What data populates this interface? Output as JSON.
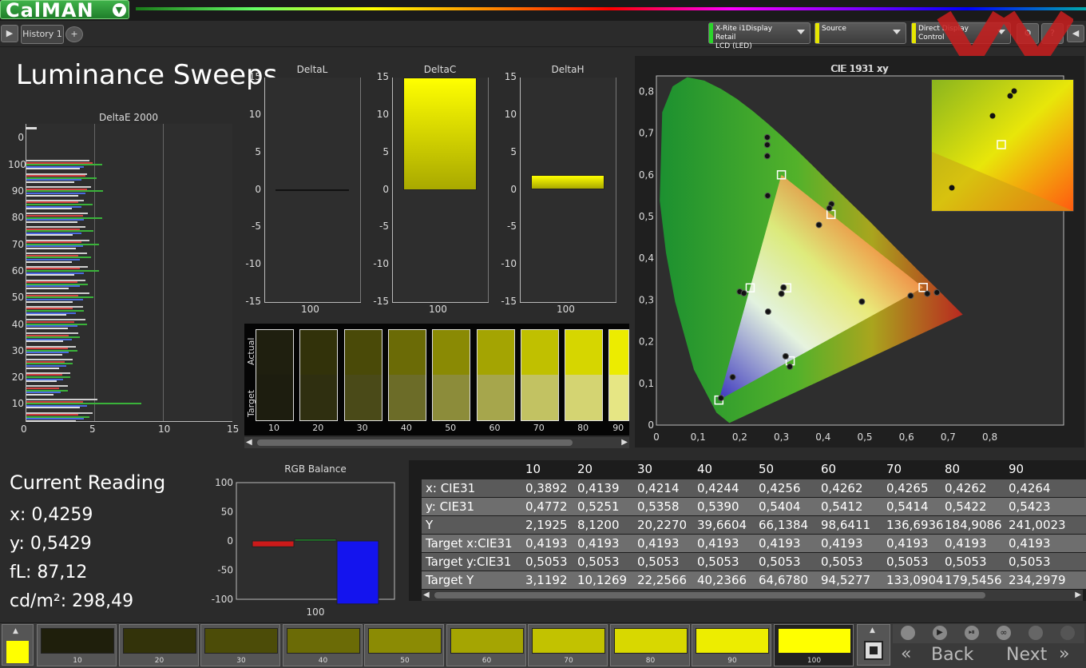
{
  "app": {
    "logo": "CalMAN",
    "history_tab": "History 1"
  },
  "toolbar": {
    "meter": {
      "line1": "X-Rite i1Display Retail",
      "line2": "LCD (LED)",
      "color": "#2bd42b"
    },
    "source": {
      "label": "Source",
      "color": "#e6e600"
    },
    "display": {
      "label": "Direct Display Control",
      "color": "#e6e600"
    }
  },
  "page_title": "Luminance Sweeps",
  "deltae": {
    "title": "DeltaE 2000",
    "xticks": [
      "0",
      "5",
      "10",
      "15"
    ],
    "yticks": [
      "0",
      "100",
      "90",
      "80",
      "70",
      "60",
      "50",
      "40",
      "30",
      "20",
      "10"
    ],
    "series_colors": [
      "#cfcfcf",
      "#d04040",
      "#3ab33a",
      "#4a6ae0",
      "#e0e0e0"
    ],
    "levels": [
      {
        "level": 100,
        "values": [
          4.6,
          4.8,
          5.5,
          4.2,
          3.9
        ]
      },
      {
        "level": 95,
        "values": [
          4.4,
          4.3,
          5.1,
          4.0,
          3.5
        ]
      },
      {
        "level": 90,
        "values": [
          4.7,
          4.4,
          5.6,
          4.3,
          3.8
        ]
      },
      {
        "level": 85,
        "values": [
          4.2,
          3.8,
          4.8,
          4.0,
          3.3
        ]
      },
      {
        "level": 80,
        "values": [
          4.5,
          4.1,
          5.5,
          4.2,
          3.7
        ]
      },
      {
        "level": 75,
        "values": [
          4.3,
          3.9,
          4.9,
          4.0,
          3.4
        ]
      },
      {
        "level": 70,
        "values": [
          4.6,
          4.0,
          5.3,
          4.1,
          3.6
        ]
      },
      {
        "level": 65,
        "values": [
          4.4,
          3.8,
          4.7,
          3.9,
          3.3
        ]
      },
      {
        "level": 60,
        "values": [
          4.5,
          3.9,
          5.3,
          4.2,
          3.5
        ]
      },
      {
        "level": 55,
        "values": [
          4.3,
          3.7,
          4.5,
          3.9,
          3.1
        ]
      },
      {
        "level": 50,
        "values": [
          4.6,
          3.8,
          4.9,
          4.1,
          3.4
        ]
      },
      {
        "level": 45,
        "values": [
          4.1,
          3.4,
          4.2,
          3.6,
          2.9
        ]
      },
      {
        "level": 40,
        "values": [
          4.3,
          3.5,
          4.4,
          3.7,
          3.0
        ]
      },
      {
        "level": 35,
        "values": [
          3.8,
          3.1,
          3.9,
          3.3,
          2.7
        ]
      },
      {
        "level": 30,
        "values": [
          3.6,
          3.0,
          3.7,
          3.1,
          2.6
        ]
      },
      {
        "level": 25,
        "values": [
          3.4,
          2.8,
          3.4,
          2.9,
          2.4
        ]
      },
      {
        "level": 20,
        "values": [
          3.2,
          2.6,
          3.2,
          2.7,
          2.2
        ]
      },
      {
        "level": 15,
        "values": [
          3.0,
          2.4,
          3.0,
          2.5,
          2.0
        ]
      },
      {
        "level": 10,
        "values": [
          5.2,
          4.1,
          8.4,
          4.4,
          3.9
        ]
      },
      {
        "level": 5,
        "values": [
          4.8,
          3.8,
          4.6,
          4.2,
          3.6
        ]
      }
    ],
    "zero_bar": 0.8
  },
  "small_charts": [
    {
      "title": "DeltaL",
      "xlabel": "100",
      "value": 0.0,
      "yticks": [
        "15",
        "10",
        "5",
        "0",
        "-5",
        "-10",
        "-15"
      ]
    },
    {
      "title": "DeltaC",
      "xlabel": "100",
      "value": 15.0,
      "yticks": [
        "15",
        "10",
        "5",
        "0",
        "-5",
        "-10",
        "-15"
      ]
    },
    {
      "title": "DeltaH",
      "xlabel": "100",
      "value": 2.0,
      "yticks": [
        "15",
        "10",
        "5",
        "0",
        "-5",
        "-10",
        "-15"
      ]
    }
  ],
  "swatches": {
    "actual_label": "Actual",
    "target_label": "Target",
    "items": [
      {
        "label": "10",
        "actual": "#1f1f0f",
        "target": "#1d1d0f"
      },
      {
        "label": "20",
        "actual": "#32320a",
        "target": "#2f2f10"
      },
      {
        "label": "30",
        "actual": "#4a4a08",
        "target": "#4a4a18"
      },
      {
        "label": "40",
        "actual": "#6b6b06",
        "target": "#6c6c28"
      },
      {
        "label": "50",
        "actual": "#8a8a04",
        "target": "#8c8c3a"
      },
      {
        "label": "60",
        "actual": "#a4a402",
        "target": "#a6a64c"
      },
      {
        "label": "70",
        "actual": "#c0c000",
        "target": "#c2c262"
      },
      {
        "label": "80",
        "actual": "#d6d600",
        "target": "#d4d472"
      },
      {
        "label": "90",
        "actual": "#ecec00",
        "target": "#e6e684"
      }
    ]
  },
  "cie": {
    "title": "CIE 1931 xy",
    "xticks": [
      "0",
      "0,1",
      "0,2",
      "0,3",
      "0,4",
      "0,5",
      "0,6",
      "0,7",
      "0,8"
    ],
    "yticks": [
      "0,8",
      "0,7",
      "0,6",
      "0,5",
      "0,4",
      "0,3",
      "0,2",
      "0,1",
      "0"
    ],
    "gamut_targets": [
      [
        0.64,
        0.33
      ],
      [
        0.3,
        0.6
      ],
      [
        0.15,
        0.06
      ],
      [
        0.3127,
        0.329
      ],
      [
        0.225,
        0.329
      ],
      [
        0.321,
        0.154
      ],
      [
        0.419,
        0.505
      ]
    ],
    "points": [
      [
        0.266,
        0.69
      ],
      [
        0.266,
        0.672
      ],
      [
        0.266,
        0.645
      ],
      [
        0.267,
        0.55
      ],
      [
        0.42,
        0.53
      ],
      [
        0.415,
        0.52
      ],
      [
        0.39,
        0.48
      ],
      [
        0.2,
        0.32
      ],
      [
        0.21,
        0.316
      ],
      [
        0.305,
        0.33
      ],
      [
        0.3,
        0.315
      ],
      [
        0.268,
        0.272
      ],
      [
        0.31,
        0.165
      ],
      [
        0.32,
        0.14
      ],
      [
        0.183,
        0.115
      ],
      [
        0.155,
        0.065
      ],
      [
        0.493,
        0.296
      ],
      [
        0.61,
        0.31
      ],
      [
        0.65,
        0.315
      ],
      [
        0.673,
        0.318
      ]
    ]
  },
  "current_reading": {
    "title": "Current Reading",
    "lines": [
      "x: 0,4259",
      "y: 0,5429",
      "fL: 87,12",
      "cd/m²: 298,49"
    ]
  },
  "rgb_balance": {
    "title": "RGB Balance",
    "xlabel": "100",
    "yticks": [
      "100",
      "50",
      "0",
      "-50",
      "-100"
    ],
    "values": {
      "red": -10,
      "green": 3,
      "blue": -108
    }
  },
  "table": {
    "columns": [
      "10",
      "20",
      "30",
      "40",
      "50",
      "60",
      "70",
      "80",
      "90"
    ],
    "rows": [
      {
        "label": "x: CIE31",
        "values": [
          "0,3892",
          "0,4139",
          "0,4214",
          "0,4244",
          "0,4256",
          "0,4262",
          "0,4265",
          "0,4262",
          "0,4264"
        ]
      },
      {
        "label": "y: CIE31",
        "values": [
          "0,4772",
          "0,5251",
          "0,5358",
          "0,5390",
          "0,5404",
          "0,5412",
          "0,5414",
          "0,5422",
          "0,5423"
        ]
      },
      {
        "label": "Y",
        "values": [
          "2,1925",
          "8,1200",
          "20,2270",
          "39,6604",
          "66,1384",
          "98,6411",
          "136,6936",
          "184,9086",
          "241,0023"
        ]
      },
      {
        "label": "Target x:CIE31",
        "values": [
          "0,4193",
          "0,4193",
          "0,4193",
          "0,4193",
          "0,4193",
          "0,4193",
          "0,4193",
          "0,4193",
          "0,4193"
        ]
      },
      {
        "label": "Target y:CIE31",
        "values": [
          "0,5053",
          "0,5053",
          "0,5053",
          "0,5053",
          "0,5053",
          "0,5053",
          "0,5053",
          "0,5053",
          "0,5053"
        ]
      },
      {
        "label": "Target Y",
        "values": [
          "3,1192",
          "10,1269",
          "22,2566",
          "40,2366",
          "64,6780",
          "94,5277",
          "133,0904",
          "179,5456",
          "234,2979"
        ]
      }
    ]
  },
  "bottom": {
    "patches": [
      {
        "label": "10",
        "color": "#1f1f0c"
      },
      {
        "label": "20",
        "color": "#33330a"
      },
      {
        "label": "30",
        "color": "#4c4c08"
      },
      {
        "label": "40",
        "color": "#6b6b06"
      },
      {
        "label": "50",
        "color": "#8b8b04"
      },
      {
        "label": "60",
        "color": "#a5a502"
      },
      {
        "label": "70",
        "color": "#c2c200"
      },
      {
        "label": "80",
        "color": "#d8d800"
      },
      {
        "label": "90",
        "color": "#eded00"
      },
      {
        "label": "100",
        "color": "#ffff00"
      }
    ],
    "back_label": "Back",
    "next_label": "Next"
  }
}
